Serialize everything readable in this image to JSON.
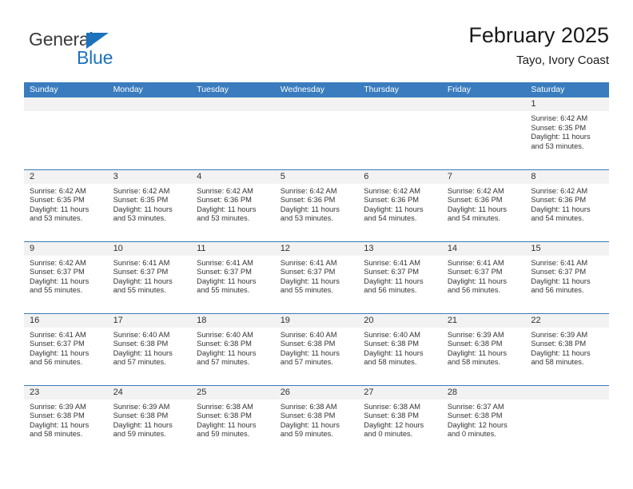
{
  "logo": {
    "primary_text": "General",
    "secondary_text": "Blue",
    "primary_color": "#3b3b3b",
    "accent_color": "#1c72bc"
  },
  "header": {
    "title": "February 2025",
    "subtitle": "Tayo, Ivory Coast"
  },
  "theme": {
    "header_blue": "#3a7cbe",
    "daynum_band": "#f2f2f2",
    "text": "#333333"
  },
  "weekdays": [
    "Sunday",
    "Monday",
    "Tuesday",
    "Wednesday",
    "Thursday",
    "Friday",
    "Saturday"
  ],
  "weeks": [
    [
      {
        "day": "",
        "sunrise": "",
        "sunset": "",
        "daylight_line1": "",
        "daylight_line2": "",
        "empty": true
      },
      {
        "day": "",
        "sunrise": "",
        "sunset": "",
        "daylight_line1": "",
        "daylight_line2": "",
        "empty": true
      },
      {
        "day": "",
        "sunrise": "",
        "sunset": "",
        "daylight_line1": "",
        "daylight_line2": "",
        "empty": true
      },
      {
        "day": "",
        "sunrise": "",
        "sunset": "",
        "daylight_line1": "",
        "daylight_line2": "",
        "empty": true
      },
      {
        "day": "",
        "sunrise": "",
        "sunset": "",
        "daylight_line1": "",
        "daylight_line2": "",
        "empty": true
      },
      {
        "day": "",
        "sunrise": "",
        "sunset": "",
        "daylight_line1": "",
        "daylight_line2": "",
        "empty": true
      },
      {
        "day": "1",
        "sunrise": "Sunrise: 6:42 AM",
        "sunset": "Sunset: 6:35 PM",
        "daylight_line1": "Daylight: 11 hours",
        "daylight_line2": "and 53 minutes.",
        "empty": false
      }
    ],
    [
      {
        "day": "2",
        "sunrise": "Sunrise: 6:42 AM",
        "sunset": "Sunset: 6:35 PM",
        "daylight_line1": "Daylight: 11 hours",
        "daylight_line2": "and 53 minutes.",
        "empty": false
      },
      {
        "day": "3",
        "sunrise": "Sunrise: 6:42 AM",
        "sunset": "Sunset: 6:35 PM",
        "daylight_line1": "Daylight: 11 hours",
        "daylight_line2": "and 53 minutes.",
        "empty": false
      },
      {
        "day": "4",
        "sunrise": "Sunrise: 6:42 AM",
        "sunset": "Sunset: 6:36 PM",
        "daylight_line1": "Daylight: 11 hours",
        "daylight_line2": "and 53 minutes.",
        "empty": false
      },
      {
        "day": "5",
        "sunrise": "Sunrise: 6:42 AM",
        "sunset": "Sunset: 6:36 PM",
        "daylight_line1": "Daylight: 11 hours",
        "daylight_line2": "and 53 minutes.",
        "empty": false
      },
      {
        "day": "6",
        "sunrise": "Sunrise: 6:42 AM",
        "sunset": "Sunset: 6:36 PM",
        "daylight_line1": "Daylight: 11 hours",
        "daylight_line2": "and 54 minutes.",
        "empty": false
      },
      {
        "day": "7",
        "sunrise": "Sunrise: 6:42 AM",
        "sunset": "Sunset: 6:36 PM",
        "daylight_line1": "Daylight: 11 hours",
        "daylight_line2": "and 54 minutes.",
        "empty": false
      },
      {
        "day": "8",
        "sunrise": "Sunrise: 6:42 AM",
        "sunset": "Sunset: 6:36 PM",
        "daylight_line1": "Daylight: 11 hours",
        "daylight_line2": "and 54 minutes.",
        "empty": false
      }
    ],
    [
      {
        "day": "9",
        "sunrise": "Sunrise: 6:42 AM",
        "sunset": "Sunset: 6:37 PM",
        "daylight_line1": "Daylight: 11 hours",
        "daylight_line2": "and 55 minutes.",
        "empty": false
      },
      {
        "day": "10",
        "sunrise": "Sunrise: 6:41 AM",
        "sunset": "Sunset: 6:37 PM",
        "daylight_line1": "Daylight: 11 hours",
        "daylight_line2": "and 55 minutes.",
        "empty": false
      },
      {
        "day": "11",
        "sunrise": "Sunrise: 6:41 AM",
        "sunset": "Sunset: 6:37 PM",
        "daylight_line1": "Daylight: 11 hours",
        "daylight_line2": "and 55 minutes.",
        "empty": false
      },
      {
        "day": "12",
        "sunrise": "Sunrise: 6:41 AM",
        "sunset": "Sunset: 6:37 PM",
        "daylight_line1": "Daylight: 11 hours",
        "daylight_line2": "and 55 minutes.",
        "empty": false
      },
      {
        "day": "13",
        "sunrise": "Sunrise: 6:41 AM",
        "sunset": "Sunset: 6:37 PM",
        "daylight_line1": "Daylight: 11 hours",
        "daylight_line2": "and 56 minutes.",
        "empty": false
      },
      {
        "day": "14",
        "sunrise": "Sunrise: 6:41 AM",
        "sunset": "Sunset: 6:37 PM",
        "daylight_line1": "Daylight: 11 hours",
        "daylight_line2": "and 56 minutes.",
        "empty": false
      },
      {
        "day": "15",
        "sunrise": "Sunrise: 6:41 AM",
        "sunset": "Sunset: 6:37 PM",
        "daylight_line1": "Daylight: 11 hours",
        "daylight_line2": "and 56 minutes.",
        "empty": false
      }
    ],
    [
      {
        "day": "16",
        "sunrise": "Sunrise: 6:41 AM",
        "sunset": "Sunset: 6:37 PM",
        "daylight_line1": "Daylight: 11 hours",
        "daylight_line2": "and 56 minutes.",
        "empty": false
      },
      {
        "day": "17",
        "sunrise": "Sunrise: 6:40 AM",
        "sunset": "Sunset: 6:38 PM",
        "daylight_line1": "Daylight: 11 hours",
        "daylight_line2": "and 57 minutes.",
        "empty": false
      },
      {
        "day": "18",
        "sunrise": "Sunrise: 6:40 AM",
        "sunset": "Sunset: 6:38 PM",
        "daylight_line1": "Daylight: 11 hours",
        "daylight_line2": "and 57 minutes.",
        "empty": false
      },
      {
        "day": "19",
        "sunrise": "Sunrise: 6:40 AM",
        "sunset": "Sunset: 6:38 PM",
        "daylight_line1": "Daylight: 11 hours",
        "daylight_line2": "and 57 minutes.",
        "empty": false
      },
      {
        "day": "20",
        "sunrise": "Sunrise: 6:40 AM",
        "sunset": "Sunset: 6:38 PM",
        "daylight_line1": "Daylight: 11 hours",
        "daylight_line2": "and 58 minutes.",
        "empty": false
      },
      {
        "day": "21",
        "sunrise": "Sunrise: 6:39 AM",
        "sunset": "Sunset: 6:38 PM",
        "daylight_line1": "Daylight: 11 hours",
        "daylight_line2": "and 58 minutes.",
        "empty": false
      },
      {
        "day": "22",
        "sunrise": "Sunrise: 6:39 AM",
        "sunset": "Sunset: 6:38 PM",
        "daylight_line1": "Daylight: 11 hours",
        "daylight_line2": "and 58 minutes.",
        "empty": false
      }
    ],
    [
      {
        "day": "23",
        "sunrise": "Sunrise: 6:39 AM",
        "sunset": "Sunset: 6:38 PM",
        "daylight_line1": "Daylight: 11 hours",
        "daylight_line2": "and 58 minutes.",
        "empty": false
      },
      {
        "day": "24",
        "sunrise": "Sunrise: 6:39 AM",
        "sunset": "Sunset: 6:38 PM",
        "daylight_line1": "Daylight: 11 hours",
        "daylight_line2": "and 59 minutes.",
        "empty": false
      },
      {
        "day": "25",
        "sunrise": "Sunrise: 6:38 AM",
        "sunset": "Sunset: 6:38 PM",
        "daylight_line1": "Daylight: 11 hours",
        "daylight_line2": "and 59 minutes.",
        "empty": false
      },
      {
        "day": "26",
        "sunrise": "Sunrise: 6:38 AM",
        "sunset": "Sunset: 6:38 PM",
        "daylight_line1": "Daylight: 11 hours",
        "daylight_line2": "and 59 minutes.",
        "empty": false
      },
      {
        "day": "27",
        "sunrise": "Sunrise: 6:38 AM",
        "sunset": "Sunset: 6:38 PM",
        "daylight_line1": "Daylight: 12 hours",
        "daylight_line2": "and 0 minutes.",
        "empty": false
      },
      {
        "day": "28",
        "sunrise": "Sunrise: 6:37 AM",
        "sunset": "Sunset: 6:38 PM",
        "daylight_line1": "Daylight: 12 hours",
        "daylight_line2": "and 0 minutes.",
        "empty": false
      },
      {
        "day": "",
        "sunrise": "",
        "sunset": "",
        "daylight_line1": "",
        "daylight_line2": "",
        "empty": true
      }
    ]
  ]
}
